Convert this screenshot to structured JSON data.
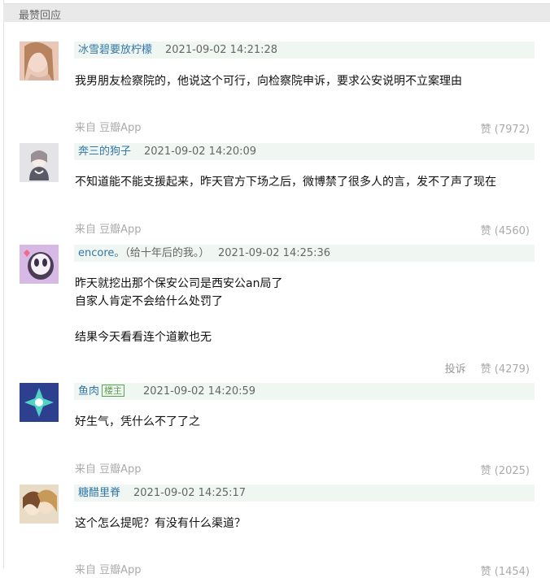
{
  "section_title": "最赞回应",
  "comments": [
    {
      "author": "冰雪碧要放柠檬",
      "time": "2021-09-02 14:21:28",
      "lines": [
        "我男朋友检察院的，他说这个可行，向检察院申诉，要求公安说明不立案理由"
      ],
      "source": "来自 豆瓣App",
      "likes": "赞 (7972)"
    },
    {
      "author": "奔三的狗子",
      "time": "2021-09-02 14:20:09",
      "lines": [
        "不知道能不能支援起来，昨天官方下场之后，微博禁了很多人的言，发不了声了现在"
      ],
      "source": "来自 豆瓣App",
      "likes": "赞 (4560)"
    },
    {
      "author": "encore。",
      "author_suffix": "（给十年后的我。）",
      "time": "2021-09-02 14:25:36",
      "lines": [
        "昨天就挖出那个保安公司是西安公an局了",
        "自家人肯定不会给什么处罚了",
        "",
        "结果今天看看连个道歉也无"
      ],
      "report": "投诉",
      "likes": "赞 (4279)"
    },
    {
      "author": "鱼肉",
      "badge": "楼主",
      "time": "2021-09-02 14:20:59",
      "lines": [
        "好生气，凭什么不了了之"
      ],
      "source": "来自 豆瓣App",
      "likes": "赞 (2025)"
    },
    {
      "author": "糖醋里脊",
      "time": "2021-09-02 14:25:17",
      "lines": [
        "这个怎么提呢？有没有什么渠道？"
      ],
      "source": "来自 豆瓣App",
      "likes": "赞 (1454)"
    }
  ]
}
